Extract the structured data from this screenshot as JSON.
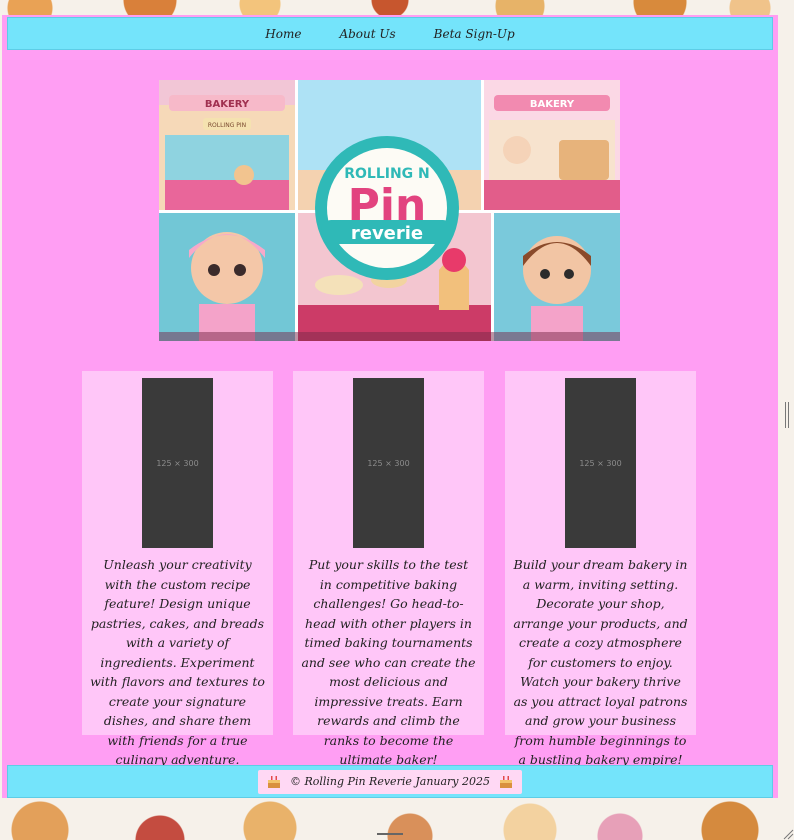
{
  "nav": {
    "items": [
      {
        "label": "Home"
      },
      {
        "label": "About Us"
      },
      {
        "label": "Beta Sign-Up"
      }
    ]
  },
  "hero": {
    "logo_line1": "ROLLING N",
    "logo_line2": "Pin",
    "logo_line3": "reverie",
    "sign_left": "BAKERY",
    "sign_right": "BAKERY",
    "sign_left_sub": "ROLLING PIN"
  },
  "cards": [
    {
      "placeholder": "125 × 300",
      "text": "Unleash your creativity with the custom recipe feature! Design unique pastries, cakes, and breads with a variety of ingredients. Experiment with flavors and textures to create your signature dishes, and share them with friends for a true culinary adventure."
    },
    {
      "placeholder": "125 × 300",
      "text": "Put your skills to the test in competitive baking challenges! Go head-to-head with other players in timed baking tournaments and see who can create the most delicious and impressive treats. Earn rewards and climb the ranks to become the ultimate baker!"
    },
    {
      "placeholder": "125 × 300",
      "text": "Build your dream bakery in a warm, inviting setting. Decorate your shop, arrange your products, and create a cozy atmosphere for customers to enjoy. Watch your bakery thrive as you attract loyal patrons and grow your business from humble beginnings to a bustling bakery empire!"
    }
  ],
  "footer": {
    "text": "© Rolling Pin Reverie January 2025",
    "icon_left": "cake-icon",
    "icon_right": "cake-icon"
  },
  "colors": {
    "page_bg": "#ff9ef3",
    "nav_bg": "#74e4fb",
    "card_bg": "#ffc6f8",
    "placeholder_bg": "#3a3a3a"
  }
}
